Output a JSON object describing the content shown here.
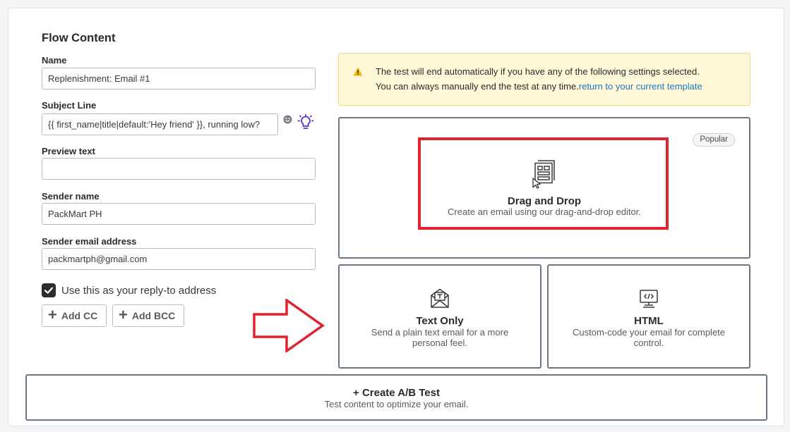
{
  "section_title": "Flow Content",
  "fields": {
    "name": {
      "label": "Name",
      "value": "Replenishment: Email #1"
    },
    "subject": {
      "label": "Subject Line",
      "value": "{{ first_name|title|default:'Hey friend' }}, running low?"
    },
    "preview": {
      "label": "Preview text",
      "value": ""
    },
    "sender_name": {
      "label": "Sender name",
      "value": "PackMart PH"
    },
    "sender_email": {
      "label": "Sender email address",
      "value": "packmartph@gmail.com"
    }
  },
  "reply_to": {
    "label": "Use this as your reply-to address",
    "checked": true
  },
  "buttons": {
    "add_cc": "Add CC",
    "add_bcc": "Add BCC"
  },
  "alert": {
    "line1": "The test will end automatically if you have any of the following settings selected.",
    "line2": "You can always manually end the test at any time.",
    "link": "return to your current template"
  },
  "options": {
    "dnd": {
      "badge": "Popular",
      "title": "Drag and Drop",
      "desc": "Create an email using our drag-and-drop editor.",
      "icon": "drag-drop-icon"
    },
    "text_only": {
      "title": "Text Only",
      "desc": "Send a plain text email for a more personal feel.",
      "icon": "envelope-text-icon"
    },
    "html": {
      "title": "HTML",
      "desc": "Custom-code your email for complete control.",
      "icon": "code-monitor-icon"
    }
  },
  "ab_test": {
    "title": "+ Create A/B Test",
    "desc": "Test content to optimize your email."
  },
  "colors": {
    "highlight": "#e0232e",
    "link": "#1f78c1",
    "alert_bg": "#fff8d8",
    "bulb": "#5b2fd0"
  }
}
